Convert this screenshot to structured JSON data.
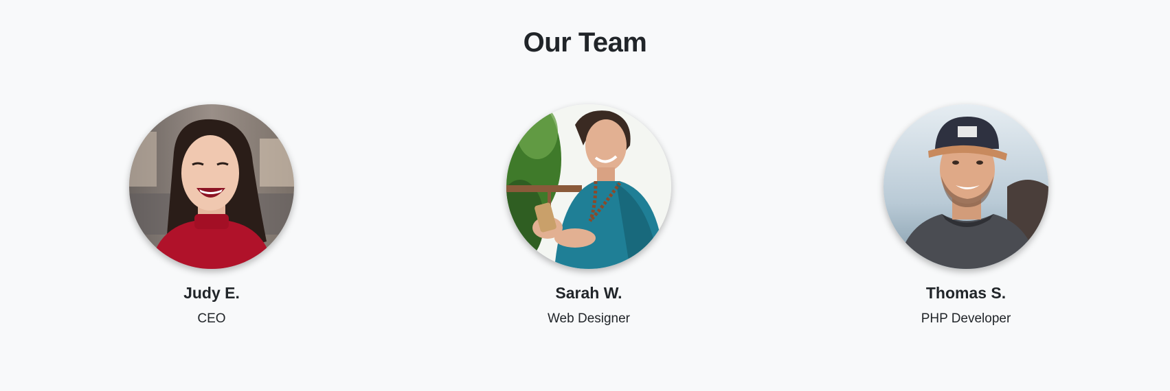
{
  "section": {
    "title": "Our Team"
  },
  "members": [
    {
      "name": "Judy E.",
      "role": "CEO",
      "photo": "woman-laughing-photo"
    },
    {
      "name": "Sarah W.",
      "role": "Web Designer",
      "photo": "woman-with-phone-photo"
    },
    {
      "name": "Thomas S.",
      "role": "PHP Developer",
      "photo": "man-with-cap-photo"
    }
  ],
  "colors": {
    "background": "#f8f9fa",
    "text": "#212529"
  }
}
